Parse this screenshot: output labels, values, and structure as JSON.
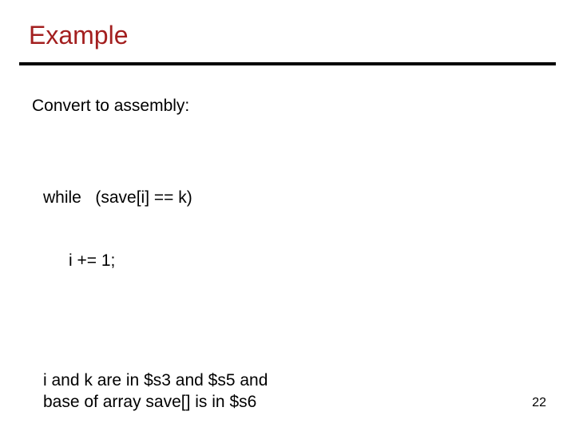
{
  "title": "Example",
  "intro": "Convert to assembly:",
  "code": {
    "line1": "while   (save[i] == k)",
    "line2": "i += 1;"
  },
  "regs": {
    "line1": "i and k are in $s3 and $s5 and",
    "line2": "base of array save[] is in $s6"
  },
  "page_number": "22"
}
